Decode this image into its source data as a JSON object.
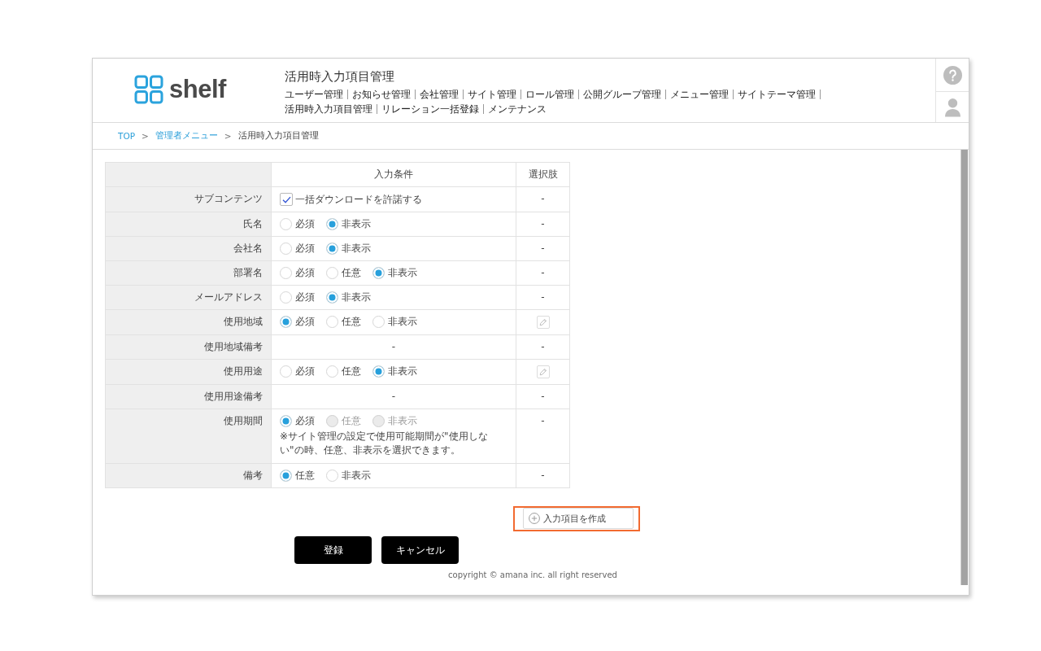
{
  "header": {
    "logo": "shelf",
    "title": "活用時入力項目管理",
    "nav": [
      {
        "label": "ユーザー管理"
      },
      {
        "label": "お知らせ管理"
      },
      {
        "label": "会社管理"
      },
      {
        "label": "サイト管理"
      },
      {
        "label": "ロール管理"
      },
      {
        "label": "公開グループ管理"
      },
      {
        "label": "メニュー管理"
      },
      {
        "label": "サイトテーマ管理"
      },
      {
        "label": "活用時入力項目管理"
      },
      {
        "label": "リレーション一括登録"
      },
      {
        "label": "メンテナンス"
      }
    ]
  },
  "breadcrumb": [
    {
      "kind": "link",
      "label": "TOP"
    },
    {
      "kind": "separator",
      "label": ">"
    },
    {
      "kind": "link",
      "label": "管理者メニュー"
    },
    {
      "kind": "separator",
      "label": ">"
    },
    {
      "kind": "current",
      "label": "活用時入力項目管理"
    }
  ],
  "table": {
    "columns": [
      {
        "label": "入力条件"
      },
      {
        "label": "選択肢"
      }
    ],
    "rows": [
      {
        "label": "サブコンテンツ",
        "kind": "checkbox",
        "checkbox": {
          "label": "一括ダウンロードを許諾する",
          "checked": true
        },
        "choices": {
          "kind": "text",
          "text": "-"
        }
      },
      {
        "label": "氏名",
        "kind": "radio",
        "options": [
          {
            "label": "必須",
            "selected": false,
            "disabled": false
          },
          {
            "label": "非表示",
            "selected": true,
            "disabled": false
          }
        ],
        "choices": {
          "kind": "text",
          "text": "-"
        }
      },
      {
        "label": "会社名",
        "kind": "radio",
        "options": [
          {
            "label": "必須",
            "selected": false,
            "disabled": false
          },
          {
            "label": "非表示",
            "selected": true,
            "disabled": false
          }
        ],
        "choices": {
          "kind": "text",
          "text": "-"
        }
      },
      {
        "label": "部署名",
        "kind": "radio",
        "options": [
          {
            "label": "必須",
            "selected": false,
            "disabled": false
          },
          {
            "label": "任意",
            "selected": false,
            "disabled": false
          },
          {
            "label": "非表示",
            "selected": true,
            "disabled": false
          }
        ],
        "choices": {
          "kind": "text",
          "text": "-"
        }
      },
      {
        "label": "メールアドレス",
        "kind": "radio",
        "options": [
          {
            "label": "必須",
            "selected": false,
            "disabled": false
          },
          {
            "label": "非表示",
            "selected": true,
            "disabled": false
          }
        ],
        "choices": {
          "kind": "text",
          "text": "-"
        }
      },
      {
        "label": "使用地域",
        "kind": "radio",
        "options": [
          {
            "label": "必須",
            "selected": true,
            "disabled": false
          },
          {
            "label": "任意",
            "selected": false,
            "disabled": false
          },
          {
            "label": "非表示",
            "selected": false,
            "disabled": false
          }
        ],
        "choices": {
          "kind": "edit"
        }
      },
      {
        "label": "使用地域備考",
        "kind": "text",
        "text": "-",
        "choices": {
          "kind": "text",
          "text": "-"
        }
      },
      {
        "label": "使用用途",
        "kind": "radio",
        "options": [
          {
            "label": "必須",
            "selected": false,
            "disabled": false
          },
          {
            "label": "任意",
            "selected": false,
            "disabled": false
          },
          {
            "label": "非表示",
            "selected": true,
            "disabled": false
          }
        ],
        "choices": {
          "kind": "edit"
        }
      },
      {
        "label": "使用用途備考",
        "kind": "text",
        "text": "-",
        "choices": {
          "kind": "text",
          "text": "-"
        }
      },
      {
        "label": "使用期間",
        "kind": "radio",
        "options": [
          {
            "label": "必須",
            "selected": true,
            "disabled": false
          },
          {
            "label": "任意",
            "selected": false,
            "disabled": true
          },
          {
            "label": "非表示",
            "selected": false,
            "disabled": true
          }
        ],
        "note": "※サイト管理の設定で使用可能期間が\"使用しない\"の時、任意、非表示を選択できます。",
        "choices": {
          "kind": "text",
          "text": "-"
        }
      },
      {
        "label": "備考",
        "kind": "radio",
        "options": [
          {
            "label": "任意",
            "selected": true,
            "disabled": false
          },
          {
            "label": "非表示",
            "selected": false,
            "disabled": false
          }
        ],
        "choices": {
          "kind": "text",
          "text": "-"
        }
      }
    ]
  },
  "create_button": {
    "label": "入力項目を作成",
    "highlighted": true
  },
  "buttons": [
    {
      "label": "登録"
    },
    {
      "label": "キャンセル"
    }
  ],
  "footer": "copyright © amana inc. all right reserved"
}
